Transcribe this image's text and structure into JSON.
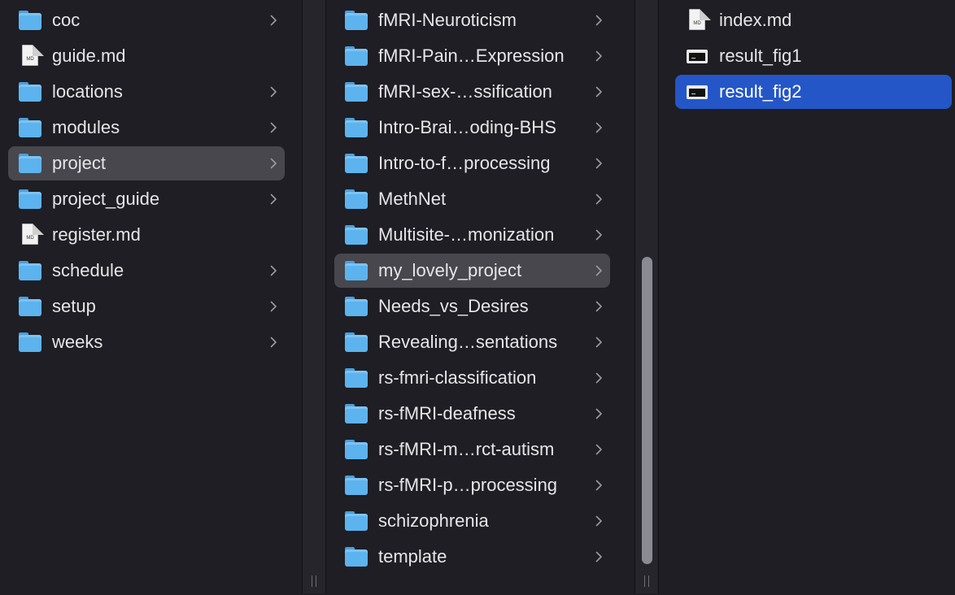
{
  "columns": [
    {
      "items": [
        {
          "label": "coc",
          "type": "folder",
          "has_children": true
        },
        {
          "label": "guide.md",
          "type": "md",
          "has_children": false
        },
        {
          "label": "locations",
          "type": "folder",
          "has_children": true
        },
        {
          "label": "modules",
          "type": "folder",
          "has_children": true
        },
        {
          "label": "project",
          "type": "folder",
          "has_children": true,
          "selected": "inactive"
        },
        {
          "label": "project_guide",
          "type": "folder",
          "has_children": true
        },
        {
          "label": "register.md",
          "type": "md",
          "has_children": false
        },
        {
          "label": "schedule",
          "type": "folder",
          "has_children": true
        },
        {
          "label": "setup",
          "type": "folder",
          "has_children": true
        },
        {
          "label": "weeks",
          "type": "folder",
          "has_children": true
        }
      ]
    },
    {
      "items": [
        {
          "label": "fMRI-Neuroticism",
          "type": "folder",
          "has_children": true
        },
        {
          "label": "fMRI-Pain…Expression",
          "type": "folder",
          "has_children": true
        },
        {
          "label": "fMRI-sex-…ssification",
          "type": "folder",
          "has_children": true
        },
        {
          "label": "Intro-Brai…oding-BHS",
          "type": "folder",
          "has_children": true
        },
        {
          "label": "Intro-to-f…processing",
          "type": "folder",
          "has_children": true
        },
        {
          "label": "MethNet",
          "type": "folder",
          "has_children": true
        },
        {
          "label": "Multisite-…monization",
          "type": "folder",
          "has_children": true
        },
        {
          "label": "my_lovely_project",
          "type": "folder",
          "has_children": true,
          "selected": "inactive"
        },
        {
          "label": "Needs_vs_Desires",
          "type": "folder",
          "has_children": true
        },
        {
          "label": "Revealing…sentations",
          "type": "folder",
          "has_children": true
        },
        {
          "label": "rs-fmri-classification",
          "type": "folder",
          "has_children": true
        },
        {
          "label": "rs-fMRI-deafness",
          "type": "folder",
          "has_children": true
        },
        {
          "label": "rs-fMRI-m…rct-autism",
          "type": "folder",
          "has_children": true
        },
        {
          "label": "rs-fMRI-p…processing",
          "type": "folder",
          "has_children": true
        },
        {
          "label": "schizophrenia",
          "type": "folder",
          "has_children": true
        },
        {
          "label": "template",
          "type": "folder",
          "has_children": true
        }
      ]
    },
    {
      "items": [
        {
          "label": "index.md",
          "type": "md",
          "has_children": false
        },
        {
          "label": "result_fig1",
          "type": "exec",
          "has_children": false
        },
        {
          "label": "result_fig2",
          "type": "exec",
          "has_children": false,
          "selected": "active"
        }
      ]
    }
  ],
  "icons": {
    "folder": "folder-icon",
    "md": "markdown-file-icon",
    "exec": "executable-file-icon",
    "chevron": "chevron-right-icon",
    "md_badge": "MD"
  },
  "colors": {
    "background": "#1e1e24",
    "selection_inactive": "#47474d",
    "selection_active": "#2456c7",
    "folder": "#5db3ee"
  }
}
